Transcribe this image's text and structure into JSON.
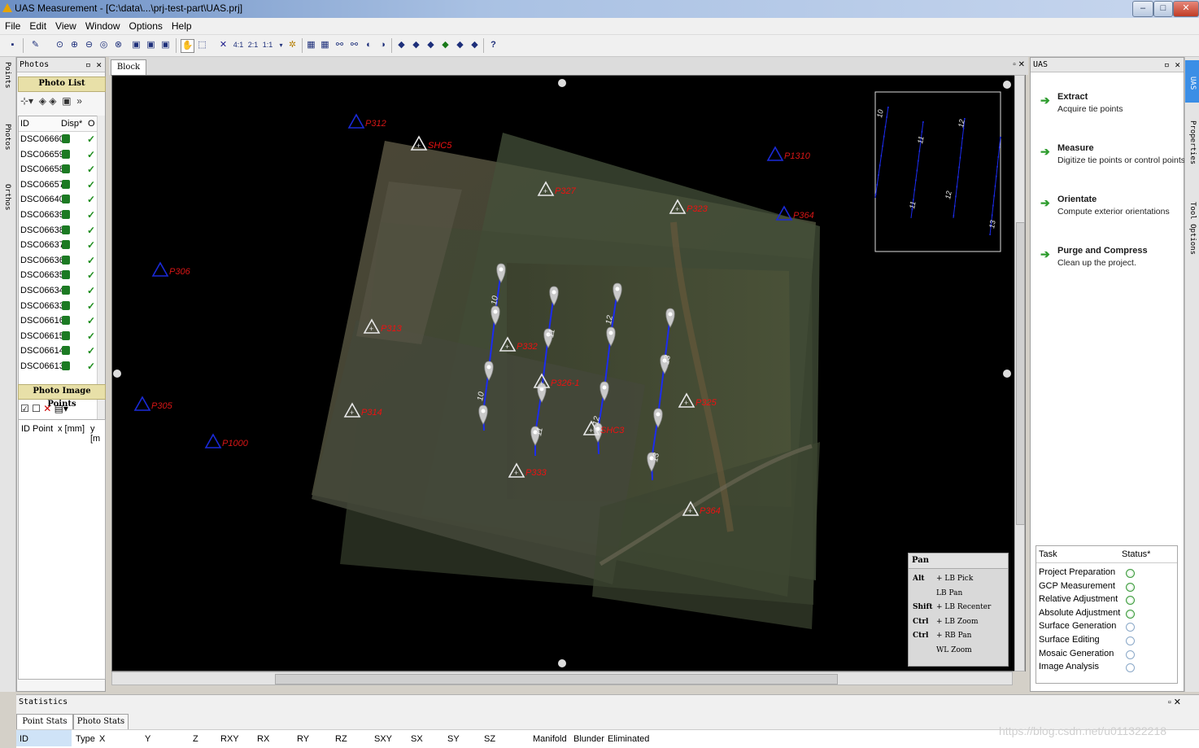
{
  "window": {
    "title": "UAS Measurement - [C:\\data\\...\\prj-test-part\\UAS.prj]",
    "controls": [
      "–",
      "□",
      "✕"
    ]
  },
  "menu": [
    "File",
    "Edit",
    "View",
    "Window",
    "Options",
    "Help"
  ],
  "toolbar": {
    "zoom_labels": [
      "4:1",
      "2:1",
      "1:1"
    ]
  },
  "left_strip": [
    "Points",
    "Photos",
    "Orthos"
  ],
  "photos_panel": {
    "title": "Photos",
    "photo_list_header": "Photo List",
    "columns": [
      "ID",
      "Disp*",
      "O"
    ],
    "rows": [
      "DSC06660",
      "DSC06659",
      "DSC06658",
      "DSC06657",
      "DSC06640",
      "DSC06639",
      "DSC06638",
      "DSC06637",
      "DSC06636",
      "DSC06635",
      "DSC06634",
      "DSC06633",
      "DSC06616",
      "DSC06615",
      "DSC06614",
      "DSC06613"
    ],
    "image_points_header": "Photo Image Points",
    "image_points_columns": [
      "ID Point",
      "x [mm]",
      "y [m"
    ]
  },
  "block": {
    "tab": "Block",
    "points": {
      "P312": "P312",
      "SHC5": "SHC5",
      "P327": "P327",
      "P323": "P323",
      "P1310": "P1310",
      "P364": "P364",
      "P306": "P306",
      "P313": "P313",
      "P332": "P332",
      "P326-1": "P326-1",
      "P314": "P314",
      "P305": "P305",
      "P1000": "P1000",
      "SHC3": "SHC3",
      "P333": "P333",
      "P325": "P325",
      "P364b": "P364"
    },
    "strips": [
      "10",
      "11",
      "12",
      "13"
    ],
    "overview_strips": [
      "10",
      "11",
      "12",
      "13"
    ],
    "pan_help": {
      "title": "Pan",
      "rows": [
        [
          "Alt",
          "+ LB Pick"
        ],
        [
          "",
          "LB Pan"
        ],
        [
          "Shift",
          "+ LB Recenter"
        ],
        [
          "Ctrl",
          "+ LB Zoom"
        ],
        [
          "Ctrl",
          "+ RB Pan"
        ],
        [
          "",
          "WL Zoom"
        ]
      ]
    }
  },
  "uas_panel": {
    "title": "UAS",
    "items": [
      {
        "label": "Extract",
        "desc": "Acquire tie points"
      },
      {
        "label": "Measure",
        "desc": "Digitize tie points or control points"
      },
      {
        "label": "Orientate",
        "desc": "Compute exterior orientations"
      },
      {
        "label": "Purge and Compress",
        "desc": "Clean up the project."
      }
    ],
    "tasks_header": [
      "Task",
      "Status*"
    ],
    "tasks": [
      {
        "name": "Project Preparation",
        "done": true
      },
      {
        "name": "GCP Measurement",
        "done": true
      },
      {
        "name": "Relative Adjustment",
        "done": true
      },
      {
        "name": "Absolute Adjustment",
        "done": true
      },
      {
        "name": "Surface Generation",
        "done": false
      },
      {
        "name": "Surface Editing",
        "done": false
      },
      {
        "name": "Mosaic Generation",
        "done": false
      },
      {
        "name": "Image Analysis",
        "done": false
      }
    ]
  },
  "right_strip": [
    "UAS",
    "Properties",
    "Tool Options"
  ],
  "statistics": {
    "title": "Statistics",
    "tabs": [
      "Point Stats",
      "Photo Stats"
    ],
    "columns": [
      "ID",
      "Type",
      "X",
      "Y",
      "Z",
      "RXY",
      "RX",
      "RY",
      "RZ",
      "SXY",
      "SX",
      "SY",
      "SZ",
      "Manifold",
      "Blunder",
      "Eliminated"
    ],
    "watermark": "https://blog.csdn.net/u011322218"
  }
}
